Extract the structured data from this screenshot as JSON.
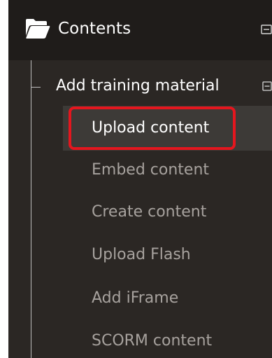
{
  "sidebar": {
    "header": {
      "label": "Contents",
      "icon": "folder-open-icon",
      "collapse_icon": "collapse-icon"
    },
    "group": {
      "label": "Add training material",
      "collapse_icon": "collapse-icon",
      "items": [
        {
          "label": "Upload content",
          "active": true
        },
        {
          "label": "Embed content",
          "active": false
        },
        {
          "label": "Create content",
          "active": false
        },
        {
          "label": "Upload Flash",
          "active": false
        },
        {
          "label": "Add iFrame",
          "active": false
        },
        {
          "label": "SCORM content",
          "active": false
        }
      ]
    }
  },
  "colors": {
    "panel_bg": "#2b2724",
    "header_bg": "#1f1c1a",
    "active_row_bg": "#3d3a37",
    "text_active": "#ffffff",
    "text_muted": "#a7a29e",
    "highlight": "#e4161e"
  }
}
